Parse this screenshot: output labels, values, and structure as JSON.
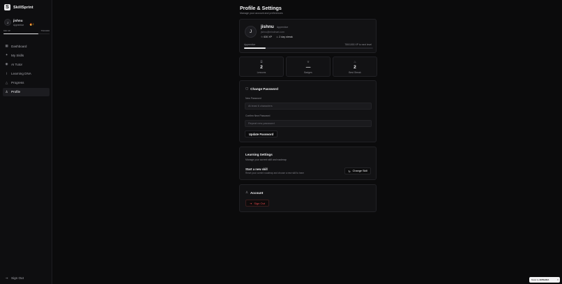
{
  "brand": {
    "name": "SkillSprint",
    "logo_icon": "S"
  },
  "sidebar_user": {
    "initial": "J",
    "name": "jishnu",
    "rank": "Apprentice",
    "flame": "🔥2",
    "xp": "630 XP",
    "xp_max": "750/1000",
    "progress_pct": 75
  },
  "nav": [
    {
      "label": "Dashboard",
      "icon": "grid-icon",
      "glyph": "▦",
      "active": false
    },
    {
      "label": "My Skills",
      "icon": "sparkle-icon",
      "glyph": "✦",
      "active": false
    },
    {
      "label": "AI Tutor",
      "icon": "bot-icon",
      "glyph": "◉",
      "active": false
    },
    {
      "label": "Learning DNA",
      "icon": "dna-icon",
      "glyph": "⌇",
      "active": false
    },
    {
      "label": "Progress",
      "icon": "trend-icon",
      "glyph": "△",
      "active": false
    },
    {
      "label": "Profile",
      "icon": "user-icon",
      "glyph": "♙",
      "active": true
    }
  ],
  "sidebar_signout": "Sign Out",
  "page": {
    "title": "Profile & Settings",
    "subtitle": "Manage your account and preferences"
  },
  "profile": {
    "initial": "J",
    "name": "jishnu",
    "rank": "Apprentice",
    "email": "jishnu@mindmart.com",
    "xp": "630 XP",
    "streak": "2 day streak",
    "level_label": "Apprentice",
    "next_level": "750/1000 XP to next level",
    "progress_pct": 17
  },
  "stats": [
    {
      "value": "2",
      "label": "Lessons",
      "icon": "book-icon",
      "glyph": "⌸"
    },
    {
      "value": "—",
      "label": "Badges",
      "icon": "trophy-icon",
      "glyph": "♕"
    },
    {
      "value": "2",
      "label": "Best Streak",
      "icon": "flame-icon",
      "glyph": "♨"
    }
  ],
  "password": {
    "heading": "Change Password",
    "new_label": "New Password",
    "new_placeholder": "At least 6 characters",
    "confirm_label": "Confirm New Password",
    "confirm_placeholder": "Repeat new password",
    "button": "Update Password"
  },
  "learning": {
    "title": "Learning Settings",
    "subtitle": "Manage your current skill and roadmap",
    "heading": "Start a new skill",
    "description": "Reset your current roadmap and choose a new skill to learn",
    "button": "Change Skill"
  },
  "account": {
    "heading": "Account",
    "signout": "Sign Out"
  },
  "made_by": {
    "prefix": "Made by",
    "brand": "ANTHARA",
    "close": "×"
  },
  "colors": {
    "accent": "#e8e8ea",
    "danger": "#e5484d",
    "streak": "#f59e0b",
    "background": "#0b0b0c"
  }
}
